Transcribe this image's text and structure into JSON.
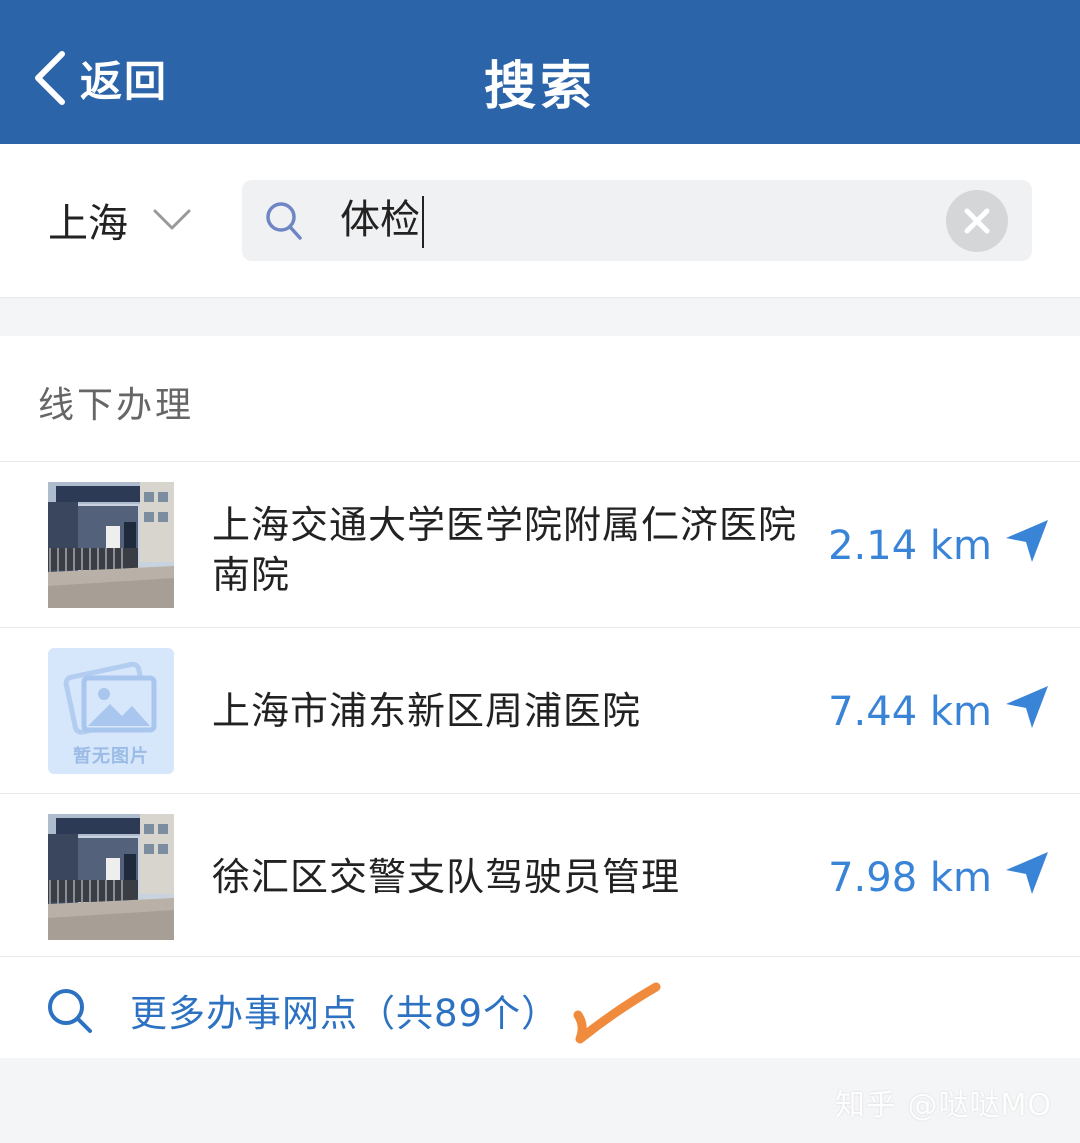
{
  "header": {
    "back_label": "返回",
    "title": "搜索"
  },
  "search": {
    "city": "上海",
    "query": "体检"
  },
  "section": {
    "title": "线下办理"
  },
  "results": [
    {
      "name": "上海交通大学医学院附属仁济医院南院",
      "distance": "2.14 km",
      "image": "building-photo"
    },
    {
      "name": "上海市浦东新区周浦医院",
      "distance": "7.44 km",
      "image": "placeholder",
      "placeholder_text": "暂无图片"
    },
    {
      "name": "徐汇区交警支队驾驶员管理",
      "distance": "7.98 km",
      "image": "building-photo"
    }
  ],
  "more": {
    "label": "更多办事网点（共89个）"
  },
  "watermark": "知乎 @哒哒MO",
  "colors": {
    "header_bg": "#2c64a9",
    "distance": "#3a84d8",
    "more_link": "#2d72c2",
    "annotation": "#f08a3c"
  },
  "icons": [
    "chevron-left-icon",
    "chevron-down-icon",
    "search-icon",
    "clear-icon",
    "navigation-arrow-icon",
    "image-placeholder-icon",
    "checkmark-annotation"
  ]
}
